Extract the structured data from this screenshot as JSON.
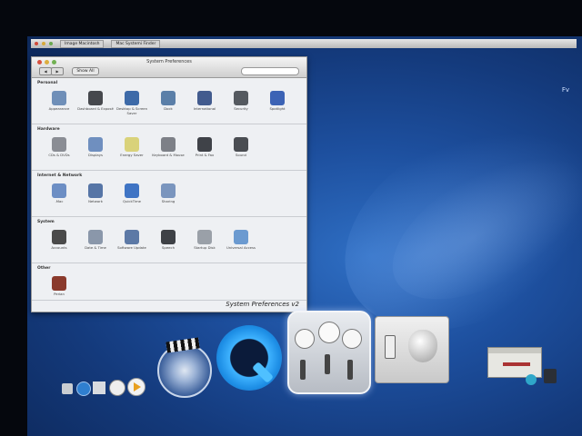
{
  "window": {
    "title": "System Preferences",
    "show_all_label": "Show All",
    "back_label": "◀",
    "forward_label": "▶",
    "caption": "System Preferences v2"
  },
  "menubar": {
    "tabs": [
      "Image Macintosh",
      "Mac Systemi Finder"
    ]
  },
  "desktop_label": "Fv",
  "sections": [
    {
      "title": "Personal",
      "items": [
        {
          "label": "Appearance",
          "icon": "appearance-icon",
          "color": "#6f8fb8"
        },
        {
          "label": "Dashboard & Exposé",
          "icon": "dashboard-icon",
          "color": "#46484d"
        },
        {
          "label": "Desktop & Screen Saver",
          "icon": "desktop-icon",
          "color": "#3d6aa8"
        },
        {
          "label": "Dock",
          "icon": "dock-icon",
          "color": "#5b7fa8"
        },
        {
          "label": "International",
          "icon": "flag-icon",
          "color": "#425b8e"
        },
        {
          "label": "Security",
          "icon": "house-icon",
          "color": "#555a60"
        },
        {
          "label": "Spotlight",
          "icon": "spotlight-icon",
          "color": "#3c63b5"
        }
      ]
    },
    {
      "title": "Hardware",
      "items": [
        {
          "label": "CDs & DVDs",
          "icon": "cd-icon",
          "color": "#8a8d94"
        },
        {
          "label": "Displays",
          "icon": "display-icon",
          "color": "#6f8fbf"
        },
        {
          "label": "Energy Saver",
          "icon": "bulb-icon",
          "color": "#d9d27a"
        },
        {
          "label": "Keyboard & Mouse",
          "icon": "keyboard-icon",
          "color": "#7d8087"
        },
        {
          "label": "Print & Fax",
          "icon": "printer-icon",
          "color": "#3f4248"
        },
        {
          "label": "Sound",
          "icon": "speaker-icon",
          "color": "#4a4d52"
        }
      ]
    },
    {
      "title": "Internet & Network",
      "items": [
        {
          "label": ".Mac",
          "icon": "mac-globe-icon",
          "color": "#6c8ec4"
        },
        {
          "label": "Network",
          "icon": "network-icon",
          "color": "#5675a6"
        },
        {
          "label": "QuickTime",
          "icon": "quicktime-icon",
          "color": "#3f74c4"
        },
        {
          "label": "Sharing",
          "icon": "sharing-icon",
          "color": "#7a95be"
        }
      ]
    },
    {
      "title": "System",
      "items": [
        {
          "label": "Accounts",
          "icon": "accounts-icon",
          "color": "#4a4a4a"
        },
        {
          "label": "Date & Time",
          "icon": "clock-icon",
          "color": "#8a97aa"
        },
        {
          "label": "Software Update",
          "icon": "update-icon",
          "color": "#5c79a6"
        },
        {
          "label": "Speech",
          "icon": "microphone-icon",
          "color": "#3e4146"
        },
        {
          "label": "Startup Disk",
          "icon": "disk-icon",
          "color": "#9aa0a8"
        },
        {
          "label": "Universal Access",
          "icon": "access-icon",
          "color": "#6b9ad0"
        }
      ]
    },
    {
      "title": "Other",
      "items": [
        {
          "label": "Perian",
          "icon": "perian-icon",
          "color": "#8a3a2c"
        }
      ]
    }
  ],
  "dock": [
    {
      "name": "finder",
      "color": "#3a8fd6"
    },
    {
      "name": "safari",
      "color": "#2f7fd0"
    },
    {
      "name": "mail",
      "color": "#cfd3d8"
    },
    {
      "name": "itunes",
      "color": "#e8e8e8"
    },
    {
      "name": "system-preferences",
      "color": "#bfc3c8"
    }
  ]
}
